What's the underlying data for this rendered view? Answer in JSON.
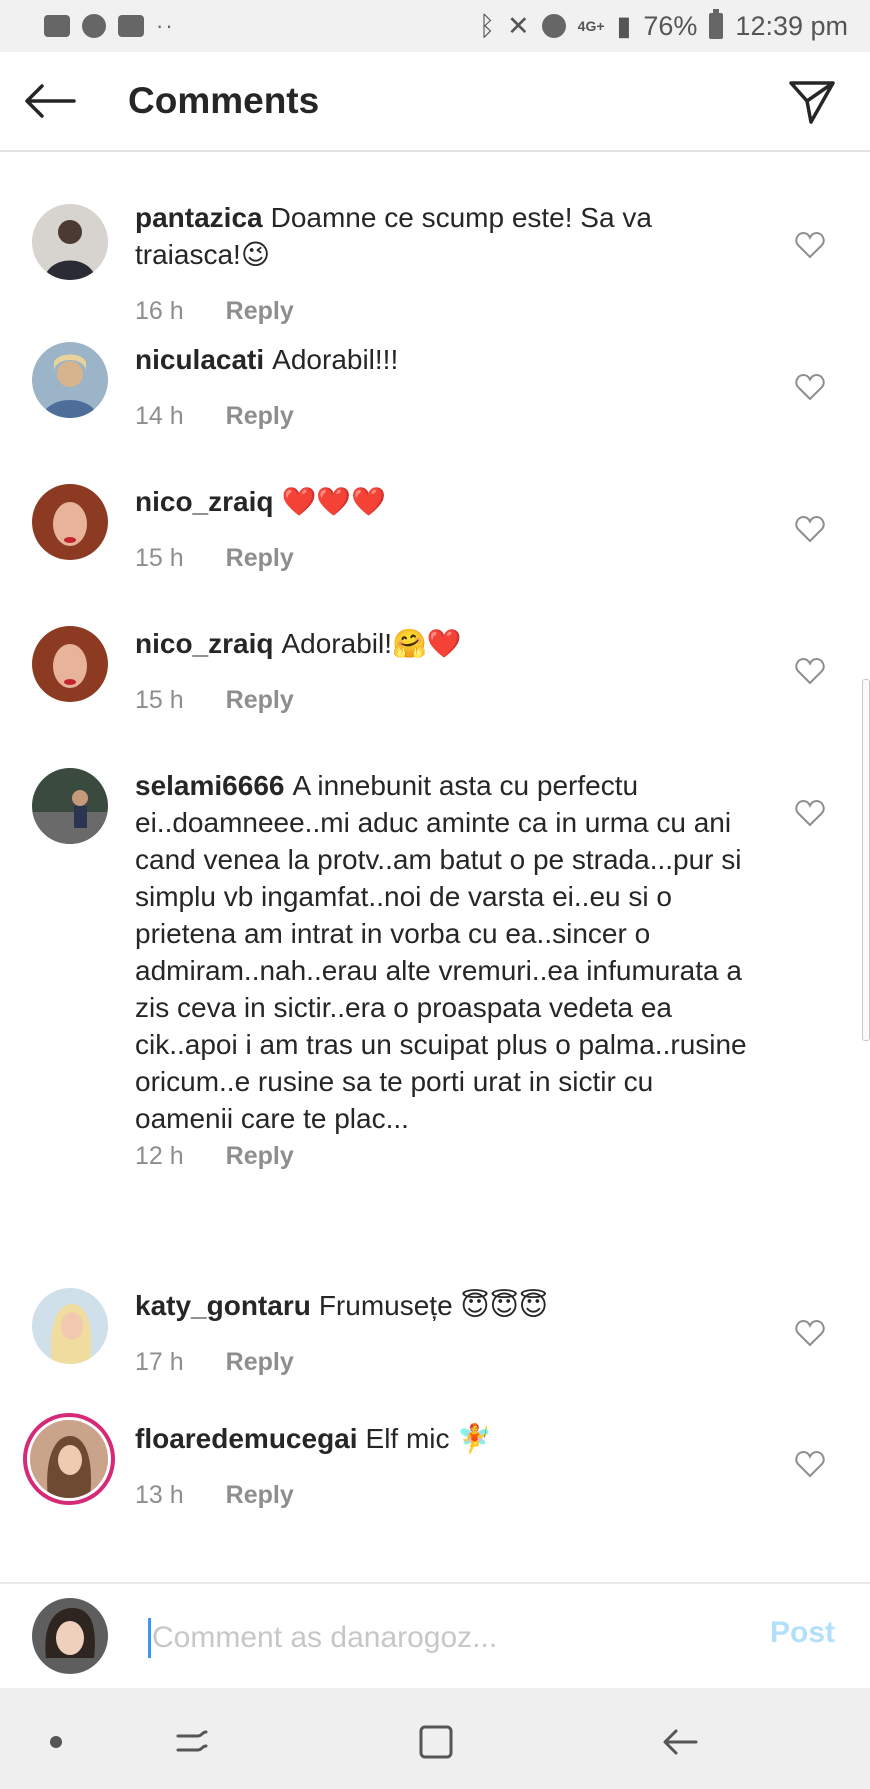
{
  "status_bar": {
    "left_icons": [
      "mail-icon",
      "whatsapp-icon",
      "gallery-icon"
    ],
    "dots": "··",
    "right_icons": [
      "bluetooth-icon",
      "mute-icon",
      "alarm-icon"
    ],
    "network": "4G+",
    "battery": "76%",
    "time": "12:39 pm"
  },
  "header": {
    "title": "Comments",
    "back_icon": "arrow-left-icon",
    "send_icon": "paper-plane-icon"
  },
  "comments": [
    {
      "username": "pantazica",
      "text": "Doamne ce scump este! Sa va traiasca!😉",
      "time": "16 h",
      "reply": "Reply"
    },
    {
      "username": "niculacati",
      "text": "Adorabil!!!",
      "time": "14 h",
      "reply": "Reply"
    },
    {
      "username": "nico_zraiq",
      "text": "❤️❤️❤️",
      "time": "15 h",
      "reply": "Reply"
    },
    {
      "username": "nico_zraiq",
      "text": "Adorabil!🤗❤️",
      "time": "15 h",
      "reply": "Reply"
    },
    {
      "username": "selami6666",
      "text": "A innebunit asta cu perfectu ei..doamneee..mi aduc aminte ca in urma cu ani cand venea la protv..am batut o pe strada...pur si simplu vb ingamfat..noi de varsta ei..eu si o prietena am intrat in vorba cu ea..sincer o admiram..nah..erau alte vremuri..ea infumurata a zis ceva in sictir..era o proaspata vedeta ea cik..apoi i am tras un scuipat plus o palma..rusine oricum..e rusine sa te porti urat in sictir cu oamenii care te plac...",
      "time": "12 h",
      "reply": "Reply"
    },
    {
      "username": "katy_gontaru",
      "text": "Frumusețe 😇😇😇",
      "time": "17 h",
      "reply": "Reply"
    },
    {
      "username": "floaredemucegai",
      "text": "Elf mic 🧚",
      "time": "13 h",
      "reply": "Reply"
    }
  ],
  "input": {
    "placeholder": "Comment as danarogoz...",
    "post_label": "Post"
  },
  "nav": {
    "icons": [
      "dot-icon",
      "recent-apps-icon",
      "home-icon",
      "back-icon"
    ]
  },
  "colors": {
    "accent": "#3897f0",
    "post_disabled": "#b2dffc",
    "meta_gray": "#8e8e8e",
    "story_ring": "#d62976"
  }
}
